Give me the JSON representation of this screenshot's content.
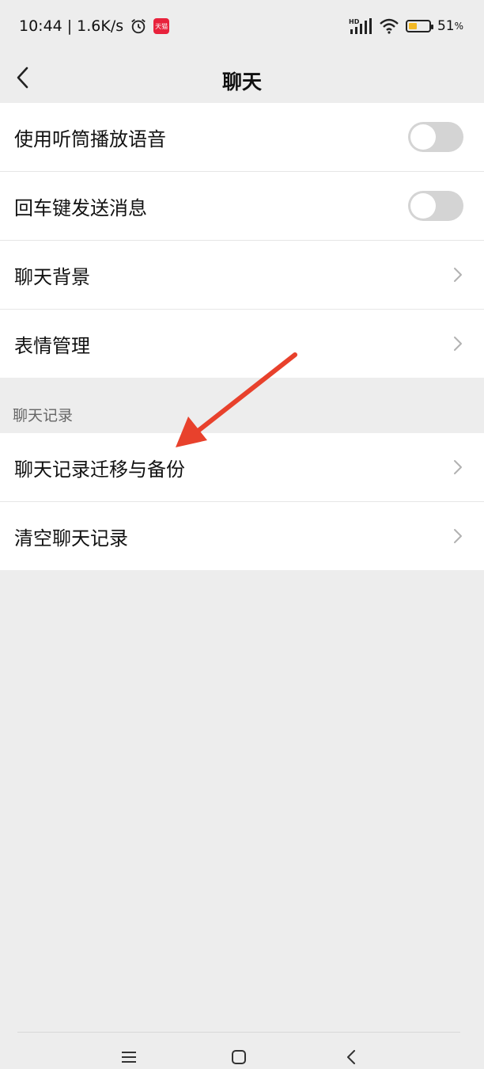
{
  "status_bar": {
    "time": "10:44",
    "separator": "|",
    "net_speed": "1.6K/s",
    "tmall_badge": "天猫",
    "network_label": "HD",
    "battery_percent": "51",
    "battery_unit": "%",
    "battery_level": 0.51,
    "icons": [
      "alarm-icon",
      "tmall-icon",
      "signal-icon",
      "wifi-icon",
      "battery-icon"
    ]
  },
  "header": {
    "back_icon": "chevron-left-icon",
    "title": "聊天"
  },
  "settings_group_1": {
    "items": [
      {
        "label": "使用听筒播放语音",
        "control": "toggle",
        "checked": false
      },
      {
        "label": "回车键发送消息",
        "control": "toggle",
        "checked": false
      },
      {
        "label": "聊天背景",
        "control": "chevron"
      },
      {
        "label": "表情管理",
        "control": "chevron"
      }
    ]
  },
  "chat_history_section": {
    "header": "聊天记录",
    "items": [
      {
        "label": "聊天记录迁移与备份",
        "control": "chevron"
      },
      {
        "label": "清空聊天记录",
        "control": "chevron"
      }
    ]
  },
  "annotation": {
    "arrow_color": "#e8412c"
  },
  "system_nav": {
    "icons": [
      "menu-icon",
      "home-icon",
      "back-icon"
    ]
  }
}
